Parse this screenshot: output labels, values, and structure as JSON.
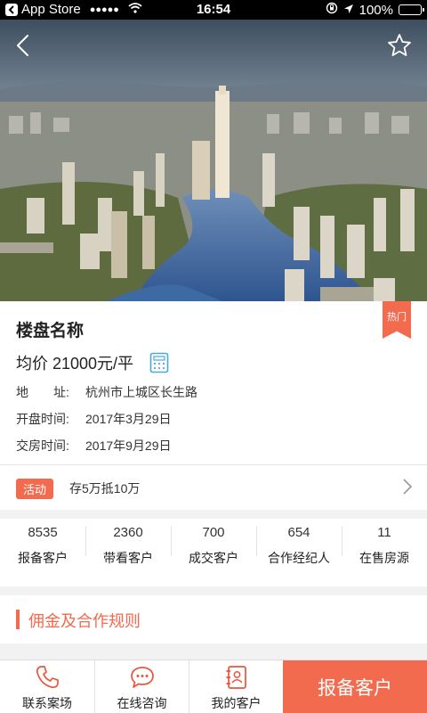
{
  "status_bar": {
    "carrier": "App Store",
    "signal": "●●●●●",
    "time": "16:54",
    "battery": "100%"
  },
  "hero": {
    "back_icon": "chevron-left-icon",
    "favorite_icon": "star-outline-icon"
  },
  "property": {
    "name": "楼盘名称",
    "hot_tag": "热门",
    "price": "均价 21000元/平",
    "calculator_icon": "calculator-icon",
    "address_label": "地　　址:",
    "address": "杭州市上城区长生路",
    "open_label": "开盘时间:",
    "open_date": "2017年3月29日",
    "delivery_label": "交房时间:",
    "delivery_date": "2017年9月29日"
  },
  "promo": {
    "badge": "活动",
    "text": "存5万抵10万"
  },
  "stats": [
    {
      "value": "8535",
      "label": "报备客户"
    },
    {
      "value": "2360",
      "label": "带看客户"
    },
    {
      "value": "700",
      "label": "成交客户"
    },
    {
      "value": "654",
      "label": "合作经纪人"
    },
    {
      "value": "11",
      "label": "在售房源"
    }
  ],
  "rules": {
    "title": "佣金及合作规则"
  },
  "tabbar": {
    "contact": "联系案场",
    "consult": "在线咨询",
    "my_clients": "我的客户",
    "primary": "报备客户"
  },
  "colors": {
    "accent": "#f26b4e",
    "tab_icon": "#e8563a"
  }
}
